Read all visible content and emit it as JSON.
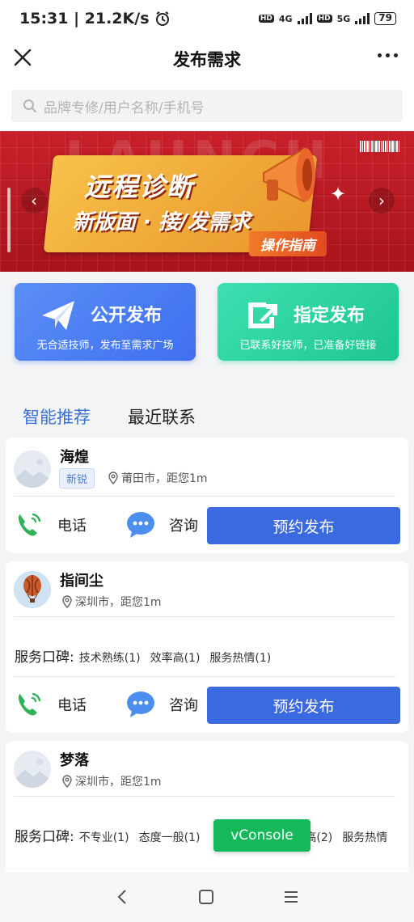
{
  "status_bar": {
    "time_speed": "15:31 | 21.2K/s",
    "network_1": "4G",
    "network_2": "5G",
    "hd": "HD",
    "battery": "79"
  },
  "nav": {
    "title": "发布需求"
  },
  "search": {
    "placeholder": "品牌专修/用户名称/手机号"
  },
  "banner": {
    "line1": "远程诊断",
    "line2": "新版面 · 接/发需求",
    "guide": "操作指南",
    "bg_text": "LAUNCH"
  },
  "publish": {
    "public": {
      "title": "公开发布",
      "subtitle": "无合适技师，发布至需求广场"
    },
    "direct": {
      "title": "指定发布",
      "subtitle": "已联系好技师，已准备好链接"
    }
  },
  "tabs": [
    {
      "label": "智能推荐",
      "active": true
    },
    {
      "label": "最近联系",
      "active": false
    }
  ],
  "actions": {
    "phone": "电话",
    "consult": "咨询",
    "book": "预约发布"
  },
  "reputation_label": "服务口碑:",
  "technicians": [
    {
      "name": "海煌",
      "tag": "新锐",
      "location": "莆田市，距您1m",
      "avatar": "placeholder"
    },
    {
      "name": "指间尘",
      "location": "深圳市，距您1m",
      "avatar": "balloon",
      "reviews": [
        "技术熟练(1)",
        "效率高(1)",
        "服务热情(1)"
      ]
    },
    {
      "name": "梦落",
      "location": "深圳市，距您1m",
      "avatar": "placeholder",
      "reviews": [
        "不专业(1)",
        "态度一般(1)"
      ],
      "reviews_cont": [
        "高(2)",
        "服务热情"
      ]
    }
  ],
  "vconsole": "vConsole",
  "colors": {
    "primary": "#3b69e0",
    "green": "#1fc690",
    "banner_red": "#c8202a"
  }
}
